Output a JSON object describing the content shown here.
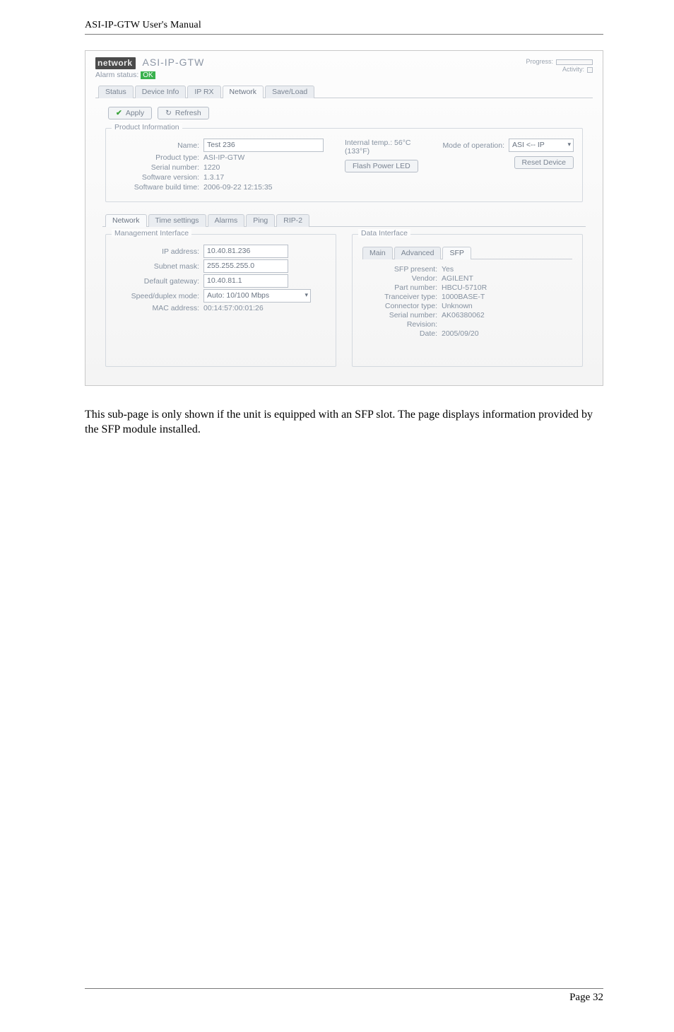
{
  "doc": {
    "header": "ASI-IP-GTW User's Manual",
    "body_text": "This sub-page is only shown if the unit is equipped with an SFP slot. The page displays information provided by the SFP module installed.",
    "footer": "Page 32"
  },
  "brand": {
    "badge": "network",
    "title": "ASI-IP-GTW",
    "alarm_label": "Alarm status:",
    "alarm_value": "OK",
    "progress_label": "Progress:",
    "activity_label": "Activity:"
  },
  "main_tabs": [
    "Status",
    "Device Info",
    "IP RX",
    "Network",
    "Save/Load"
  ],
  "main_active_index": 3,
  "actions": {
    "apply": "Apply",
    "refresh": "Refresh"
  },
  "product_info": {
    "title": "Product Information",
    "name": {
      "label": "Name:",
      "value": "Test 236"
    },
    "product_type": {
      "label": "Product type:",
      "value": "ASI-IP-GTW"
    },
    "serial_number": {
      "label": "Serial number:",
      "value": "1220"
    },
    "software_version": {
      "label": "Software version:",
      "value": "1.3.17"
    },
    "build_time": {
      "label": "Software build time:",
      "value": "2006-09-22 12:15:35"
    },
    "internal_temp": "Internal temp.: 56°C (133°F)",
    "flash_btn": "Flash Power LED",
    "mode_label": "Mode of operation:",
    "mode_value": "ASI <-- IP",
    "reset_btn": "Reset Device"
  },
  "sub_tabs": [
    "Network",
    "Time settings",
    "Alarms",
    "Ping",
    "RIP-2"
  ],
  "sub_active_index": 0,
  "management_if": {
    "title": "Management Interface",
    "ip": {
      "label": "IP address:",
      "value": "10.40.81.236"
    },
    "subnet": {
      "label": "Subnet mask:",
      "value": "255.255.255.0"
    },
    "gateway": {
      "label": "Default gateway:",
      "value": "10.40.81.1"
    },
    "speed": {
      "label": "Speed/duplex mode:",
      "value": "Auto: 10/100 Mbps"
    },
    "mac": {
      "label": "MAC address:",
      "value": "00:14:57:00:01:26"
    }
  },
  "data_if": {
    "title": "Data Interface",
    "tabs": [
      "Main",
      "Advanced",
      "SFP"
    ],
    "active_index": 2,
    "rows": {
      "sfp_present": {
        "label": "SFP present:",
        "value": "Yes"
      },
      "vendor": {
        "label": "Vendor:",
        "value": "AGILENT"
      },
      "part_number": {
        "label": "Part number:",
        "value": "HBCU-5710R"
      },
      "tranceiver_type": {
        "label": "Tranceiver type:",
        "value": "1000BASE-T"
      },
      "connector_type": {
        "label": "Connector type:",
        "value": "Unknown"
      },
      "serial_number": {
        "label": "Serial number:",
        "value": "AK06380062"
      },
      "revision": {
        "label": "Revision:",
        "value": ""
      },
      "date": {
        "label": "Date:",
        "value": "2005/09/20"
      }
    }
  }
}
